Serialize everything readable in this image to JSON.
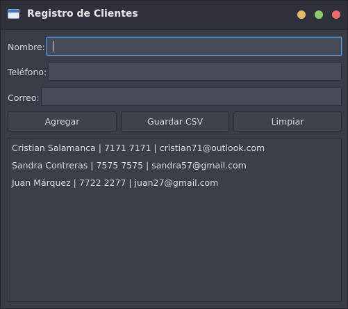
{
  "window": {
    "title": "Registro de Clientes",
    "controls": {
      "minimize_color": "#e7b76a",
      "maximize_color": "#8fcb6b",
      "close_color": "#ee6a6a"
    }
  },
  "form": {
    "nombre_label": "Nombre:",
    "nombre_value": "",
    "telefono_label": "Teléfono:",
    "telefono_value": "",
    "correo_label": "Correo:",
    "correo_value": ""
  },
  "toolbar": {
    "agregar_label": "Agregar",
    "guardar_label": "Guardar CSV",
    "limpiar_label": "Limpiar"
  },
  "clientes": [
    "Cristian Salamanca | 7171 7171 | cristian71@outlook.com",
    "Sandra Contreras | 7575 7575 | sandra57@gmail.com",
    "Juan Márquez | 7722 2277 | juan27@gmail.com"
  ],
  "colors": {
    "accent_focus": "#5a9be0",
    "background": "#383c47"
  }
}
